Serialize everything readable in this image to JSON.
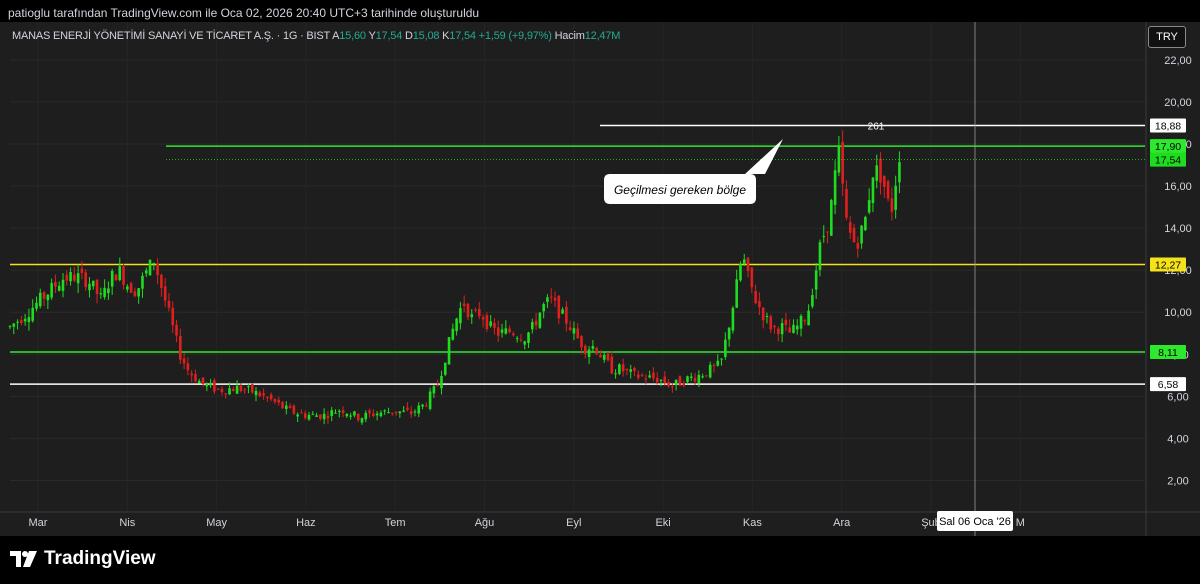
{
  "attribution": "patioglu tarafından TradingView.com ile Oca 02, 2026 20:40 UTC+3 tarihinde oluşturuldu",
  "header": {
    "symbol": "MANAS ENERJİ YÖNETİMİ SANAYİ VE TİCARET A.Ş. · 1G · BIST",
    "open_label": "A",
    "open": "15,60",
    "high_label": "Y",
    "high": "17,54",
    "low_label": "D",
    "low": "15,08",
    "close_label": "K",
    "close": "17,54",
    "change": "+1,59 (+9,97%)",
    "volume_label": "Hacim",
    "volume": "12,47M"
  },
  "currency": "TRY",
  "brand": "TradingView",
  "colors": {
    "up": "#1edc1e",
    "down": "#e01f1f",
    "green_line": "#2ee82e",
    "yellow_line": "#f5e21b",
    "white_line": "#ffffff",
    "background": "#1e1e1e"
  },
  "chart_data": {
    "type": "candlestick",
    "ylim": [
      0.5,
      23.8
    ],
    "y_ticks": [
      "2,00",
      "4,00",
      "6,00",
      "8,00",
      "10,00",
      "12,00",
      "14,00",
      "16,00",
      "18,00",
      "20,00",
      "22,00"
    ],
    "x_ticks": [
      "Mar",
      "Nis",
      "May",
      "Haz",
      "Tem",
      "Ağu",
      "Eyl",
      "Eki",
      "Kas",
      "Ara",
      "Şub",
      "M"
    ],
    "crosshair_date_label": "Sal 06 Oca '26",
    "horizontal_levels": [
      {
        "value": 18.88,
        "label": "18,88",
        "color": "white",
        "segment": "partial",
        "annotation": "261"
      },
      {
        "value": 17.9,
        "label": "17,90",
        "color": "green",
        "segment": "full"
      },
      {
        "value": 12.27,
        "label": "12,27",
        "color": "yellow",
        "segment": "full"
      },
      {
        "value": 8.11,
        "label": "8,11",
        "color": "green",
        "segment": "full"
      },
      {
        "value": 6.58,
        "label": "6,58",
        "color": "white",
        "segment": "full"
      }
    ],
    "last_price": {
      "value": 17.54,
      "label": "17,54"
    },
    "callout": "Geçilmesi gereken bölge",
    "price_path": [
      [
        0.0,
        9.3
      ],
      [
        0.02,
        10.0
      ],
      [
        0.04,
        10.8
      ],
      [
        0.06,
        11.6
      ],
      [
        0.075,
        11.7
      ],
      [
        0.09,
        11.5
      ],
      [
        0.105,
        10.6
      ],
      [
        0.115,
        11.6
      ],
      [
        0.125,
        12.0
      ],
      [
        0.135,
        11.3
      ],
      [
        0.145,
        11.0
      ],
      [
        0.155,
        11.8
      ],
      [
        0.165,
        12.5
      ],
      [
        0.175,
        11.0
      ],
      [
        0.185,
        9.5
      ],
      [
        0.195,
        8.0
      ],
      [
        0.205,
        7.2
      ],
      [
        0.22,
        6.6
      ],
      [
        0.24,
        6.3
      ],
      [
        0.26,
        6.4
      ],
      [
        0.28,
        6.2
      ],
      [
        0.3,
        5.8
      ],
      [
        0.32,
        5.3
      ],
      [
        0.34,
        5.1
      ],
      [
        0.36,
        5.1
      ],
      [
        0.38,
        5.4
      ],
      [
        0.4,
        5.0
      ],
      [
        0.42,
        5.2
      ],
      [
        0.44,
        5.3
      ],
      [
        0.46,
        5.2
      ],
      [
        0.475,
        5.6
      ],
      [
        0.49,
        6.5
      ],
      [
        0.5,
        8.0
      ],
      [
        0.51,
        9.5
      ],
      [
        0.52,
        10.5
      ],
      [
        0.53,
        9.7
      ],
      [
        0.54,
        10.0
      ],
      [
        0.55,
        9.3
      ],
      [
        0.56,
        9.0
      ],
      [
        0.575,
        9.1
      ],
      [
        0.59,
        8.8
      ],
      [
        0.6,
        9.3
      ],
      [
        0.61,
        10.2
      ],
      [
        0.62,
        10.6
      ],
      [
        0.63,
        10.0
      ],
      [
        0.64,
        9.5
      ],
      [
        0.65,
        8.8
      ],
      [
        0.66,
        8.3
      ],
      [
        0.67,
        8.4
      ],
      [
        0.68,
        7.8
      ],
      [
        0.69,
        7.3
      ],
      [
        0.7,
        7.3
      ],
      [
        0.715,
        7.0
      ],
      [
        0.73,
        6.9
      ],
      [
        0.745,
        6.8
      ],
      [
        0.76,
        6.5
      ],
      [
        0.775,
        6.8
      ],
      [
        0.79,
        7.0
      ],
      [
        0.805,
        7.3
      ],
      [
        0.815,
        7.5
      ],
      [
        0.82,
        8.5
      ],
      [
        0.83,
        10.5
      ],
      [
        0.84,
        12.8
      ],
      [
        0.845,
        11.8
      ],
      [
        0.855,
        10.6
      ],
      [
        0.865,
        9.8
      ],
      [
        0.875,
        9.2
      ],
      [
        0.885,
        9.3
      ],
      [
        0.895,
        9.0
      ],
      [
        0.905,
        9.4
      ],
      [
        0.915,
        10.0
      ],
      [
        0.93,
        13.3
      ],
      [
        0.94,
        14.5
      ],
      [
        0.95,
        17.7
      ],
      [
        0.96,
        14.0
      ],
      [
        0.97,
        13.2
      ],
      [
        0.98,
        14.2
      ],
      [
        0.99,
        16.8
      ],
      [
        1.0,
        16.5
      ],
      [
        1.01,
        14.6
      ],
      [
        1.02,
        17.54
      ]
    ]
  }
}
